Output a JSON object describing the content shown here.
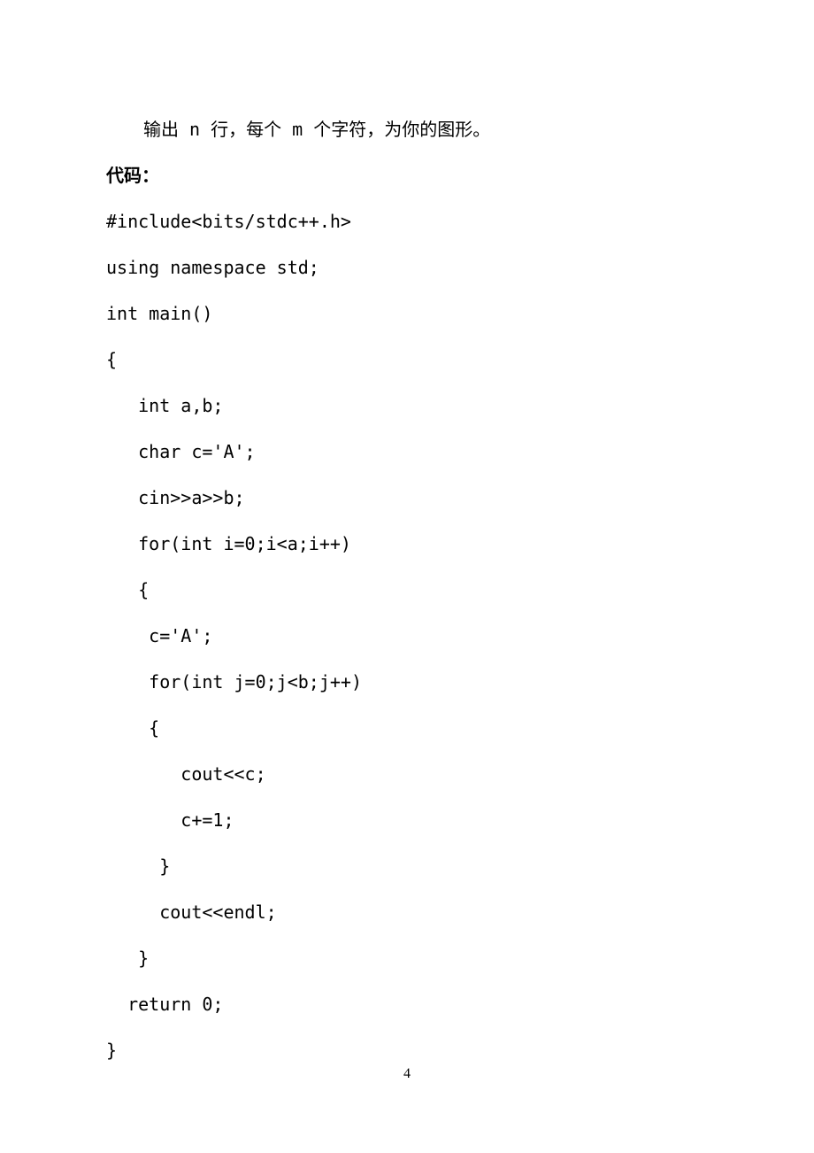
{
  "intro": "输出 n 行，每个 m 个字符，为你的图形。",
  "heading": "代码：",
  "code": {
    "l1": "#include<bits/stdc++.h>",
    "l2": "using namespace std;",
    "l3": "",
    "l4": "int main()",
    "l5": "{",
    "l6": "   int a,b;",
    "l7": "   char c='A';",
    "l8": "   cin>>a>>b;",
    "l9": "   for(int i=0;i<a;i++)",
    "l10": "   {",
    "l11": "    c='A';",
    "l12": "    for(int j=0;j<b;j++)",
    "l13": "    {",
    "l14": "       cout<<c;",
    "l15": "       c+=1;",
    "l16": "     }",
    "l17": "     cout<<endl;",
    "l18": "   }",
    "l19": "  return 0;",
    "l20": "}"
  },
  "page_number": "4"
}
